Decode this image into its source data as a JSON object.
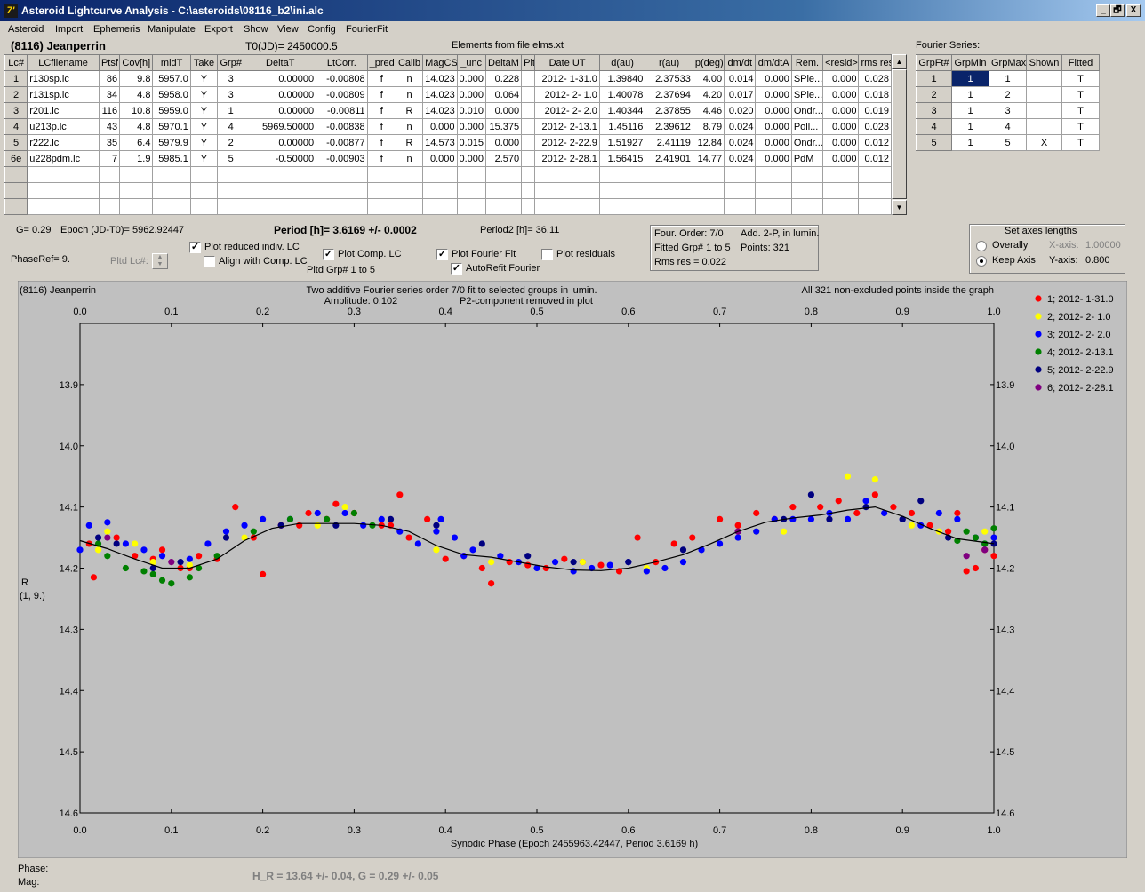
{
  "window": {
    "title": "Asteroid Lightcurve Analysis - C:\\asteroids\\08116_b2\\ini.alc",
    "icon_glyph": "7'",
    "min": "_",
    "max": "🗗",
    "close": "X"
  },
  "menu": [
    "Asteroid",
    "Import",
    "Ephemeris",
    "Manipulate",
    "Export",
    "Show",
    "View",
    "Config",
    "FourierFit"
  ],
  "header": {
    "object": "(8116) Jeanperrin",
    "t0": "T0(JD)= 2450000.5",
    "elements": "Elements from file elms.xt",
    "fourier_label": "Fourier Series:"
  },
  "lc_table": {
    "columns": [
      "Lc#",
      "LCfilename",
      "Ptsf",
      "Cov[h]",
      "midT",
      "Take",
      "Grp#",
      "DeltaT",
      "LtCorr.",
      "_pred",
      "Calib",
      "MagCS",
      "_unc",
      "DeltaM",
      "Plt",
      "Date UT",
      "d(au)",
      "r(au)",
      "p(deg)",
      "dm/dt",
      "dm/dtA",
      "Rem.",
      "<resid>",
      "rms res"
    ],
    "rows": [
      [
        "1",
        "r130sp.lc",
        "86",
        "9.8",
        "5957.0",
        "Y",
        "3",
        "0.00000",
        "-0.00808",
        "f",
        "n",
        "14.023",
        "0.000",
        "0.228",
        "",
        "2012- 1-31.0",
        "1.39840",
        "2.37533",
        "4.00",
        "0.014",
        "0.000",
        "SPle...",
        "0.000",
        "0.028"
      ],
      [
        "2",
        "r131sp.lc",
        "34",
        "4.8",
        "5958.0",
        "Y",
        "3",
        "0.00000",
        "-0.00809",
        "f",
        "n",
        "14.023",
        "0.000",
        "0.064",
        "",
        "2012- 2- 1.0",
        "1.40078",
        "2.37694",
        "4.20",
        "0.017",
        "0.000",
        "SPle...",
        "0.000",
        "0.018"
      ],
      [
        "3",
        "r201.lc",
        "116",
        "10.8",
        "5959.0",
        "Y",
        "1",
        "0.00000",
        "-0.00811",
        "f",
        "R",
        "14.023",
        "0.010",
        "0.000",
        "",
        "2012- 2- 2.0",
        "1.40344",
        "2.37855",
        "4.46",
        "0.020",
        "0.000",
        "Ondr...",
        "0.000",
        "0.019"
      ],
      [
        "4",
        "u213p.lc",
        "43",
        "4.8",
        "5970.1",
        "Y",
        "4",
        "5969.50000",
        "-0.00838",
        "f",
        "n",
        "0.000",
        "0.000",
        "15.375",
        "",
        "2012- 2-13.1",
        "1.45116",
        "2.39612",
        "8.79",
        "0.024",
        "0.000",
        "Poll...",
        "0.000",
        "0.023"
      ],
      [
        "5",
        "r222.lc",
        "35",
        "6.4",
        "5979.9",
        "Y",
        "2",
        "0.00000",
        "-0.00877",
        "f",
        "R",
        "14.573",
        "0.015",
        "0.000",
        "",
        "2012- 2-22.9",
        "1.51927",
        "2.41119",
        "12.84",
        "0.024",
        "0.000",
        "Ondr...",
        "0.000",
        "0.012"
      ],
      [
        "6e",
        "u228pdm.lc",
        "7",
        "1.9",
        "5985.1",
        "Y",
        "5",
        "-0.50000",
        "-0.00903",
        "f",
        "n",
        "0.000",
        "0.000",
        "2.570",
        "",
        "2012- 2-28.1",
        "1.56415",
        "2.41901",
        "14.77",
        "0.024",
        "0.000",
        "PdM",
        "0.000",
        "0.012"
      ]
    ]
  },
  "fourier_table": {
    "columns": [
      "GrpFt#",
      "GrpMin",
      "GrpMax",
      "Shown",
      "Fitted"
    ],
    "rows": [
      [
        "1",
        "1",
        "1",
        "",
        "T"
      ],
      [
        "2",
        "1",
        "2",
        "",
        "T"
      ],
      [
        "3",
        "1",
        "3",
        "",
        "T"
      ],
      [
        "4",
        "1",
        "4",
        "",
        "T"
      ],
      [
        "5",
        "1",
        "5",
        "X",
        "T"
      ]
    ]
  },
  "params": {
    "g": "G= 0.29",
    "epoch": "Epoch (JD-T0)= 5962.92447",
    "period": "Period [h]= 3.6169 +/- 0.0002",
    "period2": "Period2 [h]= 36.11",
    "phaseref": "PhaseRef= 9.",
    "pltd_lc": "Pltd Lc#:",
    "pltd_grp": "Pltd Grp#  1   to   5"
  },
  "options": {
    "plot_reduced": "Plot reduced indiv. LC",
    "align_comp": "Align with Comp. LC",
    "plot_comp": "Plot Comp. LC",
    "plot_fourier": "Plot Fourier Fit",
    "autorefit": "AutoRefit Fourier",
    "plot_residuals": "Plot residuals",
    "check": "✓"
  },
  "fit_info": {
    "order": "Four. Order:  7/0",
    "add": "Add. 2-P, in lumin.",
    "fitted": "Fitted Grp# 1 to 5",
    "points": "Points: 321",
    "rms": "Rms res     = 0.022"
  },
  "axes_box": {
    "title": "Set axes lengths",
    "overally": "Overally",
    "keep": "Keep Axis",
    "xaxis": "X-axis:",
    "xval": "1.00000",
    "yaxis": "Y-axis:",
    "yval": "0.800"
  },
  "status": {
    "phase": "Phase:",
    "mag": "Mag:",
    "hg": "H_R = 13.64 +/- 0.04, G = 0.29 +/- 0.05"
  },
  "chart_data": {
    "type": "scatter",
    "title_left": "(8116) Jeanperrin",
    "title_center": "Two additive Fourier series order 7/0 fit to selected groups in lumin.",
    "amplitude": "Amplitude: 0.102",
    "p2": "P2-component removed in plot",
    "title_right": "All 321 non-excluded points inside the graph",
    "xlabel": "Synodic Phase (Epoch 2455963.42447, Period 3.6169 h)",
    "ylabel": "R",
    "ylabel2": "(1, 9.)",
    "xlim": [
      0,
      1
    ],
    "ylim": [
      14.6,
      13.8
    ],
    "xticks": [
      0,
      0.1,
      0.2,
      0.3,
      0.4,
      0.5,
      0.6,
      0.7,
      0.8,
      0.9,
      1.0
    ],
    "xtick_labels": [
      "0.0",
      "0.1",
      "0.2",
      "0.3",
      "0.4",
      "0.5",
      "0.6",
      "0.7",
      "0.8",
      "0.9",
      "1.0"
    ],
    "yticks": [
      13.9,
      14.0,
      14.1,
      14.2,
      14.3,
      14.4,
      14.5,
      14.6
    ],
    "ytick_labels": [
      "13.9",
      "14.0",
      "14.1",
      "14.2",
      "14.3",
      "14.4",
      "14.5",
      "14.6"
    ],
    "legend": [
      {
        "label": "1; 2012- 1-31.0",
        "color": "#ff0000"
      },
      {
        "label": "2; 2012- 2- 1.0",
        "color": "#ffff00"
      },
      {
        "label": "3; 2012- 2- 2.0",
        "color": "#0000ff"
      },
      {
        "label": "4; 2012- 2-13.1",
        "color": "#008000"
      },
      {
        "label": "5; 2012- 2-22.9",
        "color": "#000080"
      },
      {
        "label": "6; 2012- 2-28.1",
        "color": "#800080"
      }
    ],
    "fit_curve": {
      "x": [
        0,
        0.03,
        0.06,
        0.09,
        0.12,
        0.15,
        0.18,
        0.21,
        0.24,
        0.27,
        0.3,
        0.33,
        0.36,
        0.39,
        0.42,
        0.45,
        0.48,
        0.51,
        0.54,
        0.57,
        0.6,
        0.63,
        0.66,
        0.69,
        0.72,
        0.75,
        0.78,
        0.81,
        0.84,
        0.87,
        0.9,
        0.93,
        0.96,
        1.0
      ],
      "y": [
        14.155,
        14.168,
        14.185,
        14.2,
        14.2,
        14.185,
        14.155,
        14.135,
        14.127,
        14.127,
        14.127,
        14.13,
        14.14,
        14.163,
        14.178,
        14.182,
        14.19,
        14.198,
        14.203,
        14.204,
        14.2,
        14.19,
        14.178,
        14.16,
        14.14,
        14.125,
        14.118,
        14.113,
        14.105,
        14.1,
        14.115,
        14.135,
        14.152,
        14.16
      ]
    },
    "points": [
      [
        0.01,
        14.16,
        0
      ],
      [
        0.015,
        14.215,
        0
      ],
      [
        0.04,
        14.15,
        0
      ],
      [
        0.06,
        14.18,
        0
      ],
      [
        0.08,
        14.185,
        0
      ],
      [
        0.09,
        14.17,
        0
      ],
      [
        0.11,
        14.2,
        0
      ],
      [
        0.12,
        14.2,
        0
      ],
      [
        0.13,
        14.18,
        0
      ],
      [
        0.15,
        14.185,
        0
      ],
      [
        0.17,
        14.1,
        0
      ],
      [
        0.19,
        14.15,
        0
      ],
      [
        0.2,
        14.21,
        0
      ],
      [
        0.22,
        14.13,
        0
      ],
      [
        0.24,
        14.13,
        0
      ],
      [
        0.25,
        14.11,
        0
      ],
      [
        0.27,
        14.12,
        0
      ],
      [
        0.28,
        14.095,
        0
      ],
      [
        0.3,
        14.11,
        0
      ],
      [
        0.33,
        14.13,
        0
      ],
      [
        0.34,
        14.13,
        0
      ],
      [
        0.35,
        14.08,
        0
      ],
      [
        0.36,
        14.15,
        0
      ],
      [
        0.38,
        14.12,
        0
      ],
      [
        0.4,
        14.185,
        0
      ],
      [
        0.42,
        14.18,
        0
      ],
      [
        0.44,
        14.2,
        0
      ],
      [
        0.45,
        14.225,
        0
      ],
      [
        0.47,
        14.19,
        0
      ],
      [
        0.49,
        14.195,
        0
      ],
      [
        0.51,
        14.2,
        0
      ],
      [
        0.53,
        14.185,
        0
      ],
      [
        0.55,
        14.19,
        0
      ],
      [
        0.57,
        14.195,
        0
      ],
      [
        0.59,
        14.205,
        0
      ],
      [
        0.61,
        14.15,
        0
      ],
      [
        0.63,
        14.19,
        0
      ],
      [
        0.65,
        14.16,
        0
      ],
      [
        0.67,
        14.15,
        0
      ],
      [
        0.7,
        14.12,
        0
      ],
      [
        0.72,
        14.13,
        0
      ],
      [
        0.74,
        14.11,
        0
      ],
      [
        0.76,
        14.12,
        0
      ],
      [
        0.78,
        14.1,
        0
      ],
      [
        0.81,
        14.1,
        0
      ],
      [
        0.83,
        14.09,
        0
      ],
      [
        0.85,
        14.11,
        0
      ],
      [
        0.87,
        14.08,
        0
      ],
      [
        0.89,
        14.1,
        0
      ],
      [
        0.91,
        14.11,
        0
      ],
      [
        0.93,
        14.13,
        0
      ],
      [
        0.95,
        14.14,
        0
      ],
      [
        0.97,
        14.205,
        0
      ],
      [
        0.98,
        14.2,
        0
      ],
      [
        0.99,
        14.17,
        0
      ],
      [
        1.0,
        14.18,
        0
      ],
      [
        0.96,
        14.11,
        0
      ],
      [
        0.02,
        14.17,
        1
      ],
      [
        0.03,
        14.14,
        1
      ],
      [
        0.06,
        14.16,
        1
      ],
      [
        0.08,
        14.19,
        1
      ],
      [
        0.12,
        14.195,
        1
      ],
      [
        0.18,
        14.15,
        1
      ],
      [
        0.26,
        14.13,
        1
      ],
      [
        0.29,
        14.1,
        1
      ],
      [
        0.39,
        14.17,
        1
      ],
      [
        0.45,
        14.19,
        1
      ],
      [
        0.55,
        14.19,
        1
      ],
      [
        0.62,
        14.2,
        1
      ],
      [
        0.74,
        14.14,
        1
      ],
      [
        0.77,
        14.14,
        1
      ],
      [
        0.84,
        14.05,
        1
      ],
      [
        0.87,
        14.055,
        1
      ],
      [
        0.91,
        14.13,
        1
      ],
      [
        0.94,
        14.14,
        1
      ],
      [
        0.99,
        14.14,
        1
      ],
      [
        1.0,
        14.16,
        1
      ],
      [
        0.0,
        14.17,
        2
      ],
      [
        0.01,
        14.13,
        2
      ],
      [
        0.03,
        14.125,
        2
      ],
      [
        0.05,
        14.16,
        2
      ],
      [
        0.07,
        14.17,
        2
      ],
      [
        0.09,
        14.18,
        2
      ],
      [
        0.12,
        14.185,
        2
      ],
      [
        0.14,
        14.16,
        2
      ],
      [
        0.16,
        14.14,
        2
      ],
      [
        0.18,
        14.13,
        2
      ],
      [
        0.2,
        14.12,
        2
      ],
      [
        0.23,
        14.12,
        2
      ],
      [
        0.26,
        14.11,
        2
      ],
      [
        0.29,
        14.11,
        2
      ],
      [
        0.31,
        14.13,
        2
      ],
      [
        0.33,
        14.12,
        2
      ],
      [
        0.35,
        14.14,
        2
      ],
      [
        0.37,
        14.16,
        2
      ],
      [
        0.39,
        14.14,
        2
      ],
      [
        0.41,
        14.15,
        2
      ],
      [
        0.43,
        14.17,
        2
      ],
      [
        0.46,
        14.18,
        2
      ],
      [
        0.48,
        14.19,
        2
      ],
      [
        0.5,
        14.2,
        2
      ],
      [
        0.52,
        14.19,
        2
      ],
      [
        0.54,
        14.205,
        2
      ],
      [
        0.56,
        14.2,
        2
      ],
      [
        0.58,
        14.195,
        2
      ],
      [
        0.6,
        14.19,
        2
      ],
      [
        0.62,
        14.205,
        2
      ],
      [
        0.64,
        14.2,
        2
      ],
      [
        0.66,
        14.19,
        2
      ],
      [
        0.68,
        14.17,
        2
      ],
      [
        0.7,
        14.16,
        2
      ],
      [
        0.72,
        14.15,
        2
      ],
      [
        0.74,
        14.14,
        2
      ],
      [
        0.76,
        14.12,
        2
      ],
      [
        0.78,
        14.12,
        2
      ],
      [
        0.8,
        14.12,
        2
      ],
      [
        0.82,
        14.11,
        2
      ],
      [
        0.84,
        14.12,
        2
      ],
      [
        0.86,
        14.09,
        2
      ],
      [
        0.88,
        14.11,
        2
      ],
      [
        0.9,
        14.12,
        2
      ],
      [
        0.92,
        14.13,
        2
      ],
      [
        0.94,
        14.11,
        2
      ],
      [
        0.96,
        14.12,
        2
      ],
      [
        0.98,
        14.15,
        2
      ],
      [
        0.99,
        14.16,
        2
      ],
      [
        1.0,
        14.15,
        2
      ],
      [
        0.395,
        14.12,
        2
      ],
      [
        0.42,
        14.18,
        2
      ],
      [
        0.02,
        14.16,
        3
      ],
      [
        0.03,
        14.18,
        3
      ],
      [
        0.05,
        14.2,
        3
      ],
      [
        0.07,
        14.205,
        3
      ],
      [
        0.08,
        14.21,
        3
      ],
      [
        0.09,
        14.22,
        3
      ],
      [
        0.1,
        14.225,
        3
      ],
      [
        0.12,
        14.215,
        3
      ],
      [
        0.13,
        14.2,
        3
      ],
      [
        0.15,
        14.18,
        3
      ],
      [
        0.19,
        14.14,
        3
      ],
      [
        0.23,
        14.12,
        3
      ],
      [
        0.27,
        14.12,
        3
      ],
      [
        0.3,
        14.11,
        3
      ],
      [
        0.32,
        14.13,
        3
      ],
      [
        0.97,
        14.14,
        3
      ],
      [
        0.98,
        14.15,
        3
      ],
      [
        0.99,
        14.16,
        3
      ],
      [
        1.0,
        14.135,
        3
      ],
      [
        0.96,
        14.155,
        3
      ],
      [
        0.02,
        14.15,
        4
      ],
      [
        0.04,
        14.16,
        4
      ],
      [
        0.08,
        14.2,
        4
      ],
      [
        0.11,
        14.19,
        4
      ],
      [
        0.16,
        14.15,
        4
      ],
      [
        0.22,
        14.13,
        4
      ],
      [
        0.28,
        14.13,
        4
      ],
      [
        0.34,
        14.12,
        4
      ],
      [
        0.39,
        14.13,
        4
      ],
      [
        0.44,
        14.16,
        4
      ],
      [
        0.49,
        14.18,
        4
      ],
      [
        0.54,
        14.19,
        4
      ],
      [
        0.6,
        14.19,
        4
      ],
      [
        0.66,
        14.17,
        4
      ],
      [
        0.72,
        14.14,
        4
      ],
      [
        0.77,
        14.12,
        4
      ],
      [
        0.82,
        14.12,
        4
      ],
      [
        0.86,
        14.1,
        4
      ],
      [
        0.9,
        14.12,
        4
      ],
      [
        0.95,
        14.15,
        4
      ],
      [
        1.0,
        14.16,
        4
      ],
      [
        0.8,
        14.08,
        4
      ],
      [
        0.92,
        14.09,
        4
      ],
      [
        0.03,
        14.15,
        5
      ],
      [
        0.1,
        14.19,
        5
      ],
      [
        0.97,
        14.18,
        5
      ],
      [
        0.99,
        14.17,
        5
      ],
      [
        0.72,
        14.14,
        5
      ]
    ]
  }
}
